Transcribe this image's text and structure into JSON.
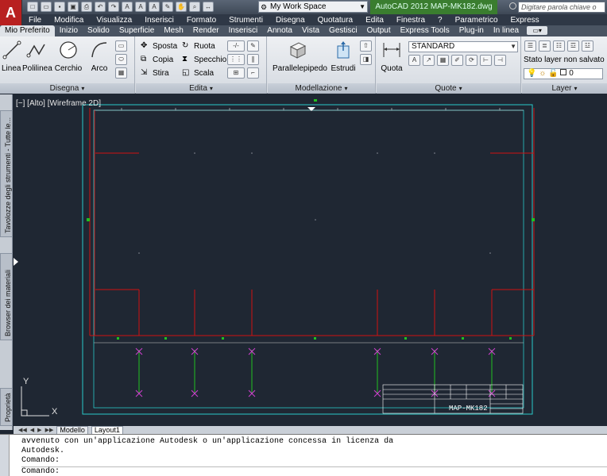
{
  "titlebar": {
    "app_letter": "A",
    "workspace": "My Work Space",
    "document_title": "AutoCAD 2012   MAP-MK182.dwg",
    "search_placeholder": "Digitare parola chiave o frase"
  },
  "menu": [
    "File",
    "Modifica",
    "Visualizza",
    "Inserisci",
    "Formato",
    "Strumenti",
    "Disegna",
    "Quotatura",
    "Edita",
    "Finestra",
    "?",
    "Parametrico",
    "Express"
  ],
  "tabs": [
    "Mio Preferito",
    "Inizio",
    "Solido",
    "Superficie",
    "Mesh",
    "Render",
    "Inserisci",
    "Annota",
    "Vista",
    "Gestisci",
    "Output",
    "Express Tools",
    "Plug-in",
    "In linea"
  ],
  "ribbon": {
    "disegna": {
      "title": "Disegna",
      "tools": [
        "Linea",
        "Polilinea",
        "Cerchio",
        "Arco"
      ]
    },
    "edita": {
      "title": "Edita",
      "tools": [
        "Sposta",
        "Ruota",
        "Copia",
        "Specchio",
        "Stira",
        "Scala"
      ]
    },
    "modellazione": {
      "title": "Modellazione",
      "tools": [
        "Parallelepipedo",
        "Estrudi"
      ]
    },
    "quote": {
      "title": "Quote",
      "tool": "Quota",
      "style": "STANDARD"
    },
    "layer": {
      "title": "Layer",
      "state": "Stato layer non salvato",
      "current": "0"
    }
  },
  "palettes": [
    "Tavolozze degli strumenti - Tutte le...",
    "Browser dei materiali",
    "Proprietà"
  ],
  "viewport": {
    "label": "[−] [Alto] [Wireframe 2D]"
  },
  "layout_tabs": [
    "Modello",
    "Layout1"
  ],
  "title_block": {
    "drawing_number": "MAP-MK182"
  },
  "ucs": {
    "x": "X",
    "y": "Y"
  },
  "command": {
    "history": [
      "avvenuto con un'applicazione Autodesk o un'applicazione concessa in licenza da",
      "Autodesk."
    ],
    "prompt1": "Comando:",
    "prompt2": "Comando:"
  },
  "colors": {
    "frame_red": "#d01010",
    "border_cyan": "#2ac8c8",
    "green": "#20c020",
    "magenta": "#d040d0"
  }
}
